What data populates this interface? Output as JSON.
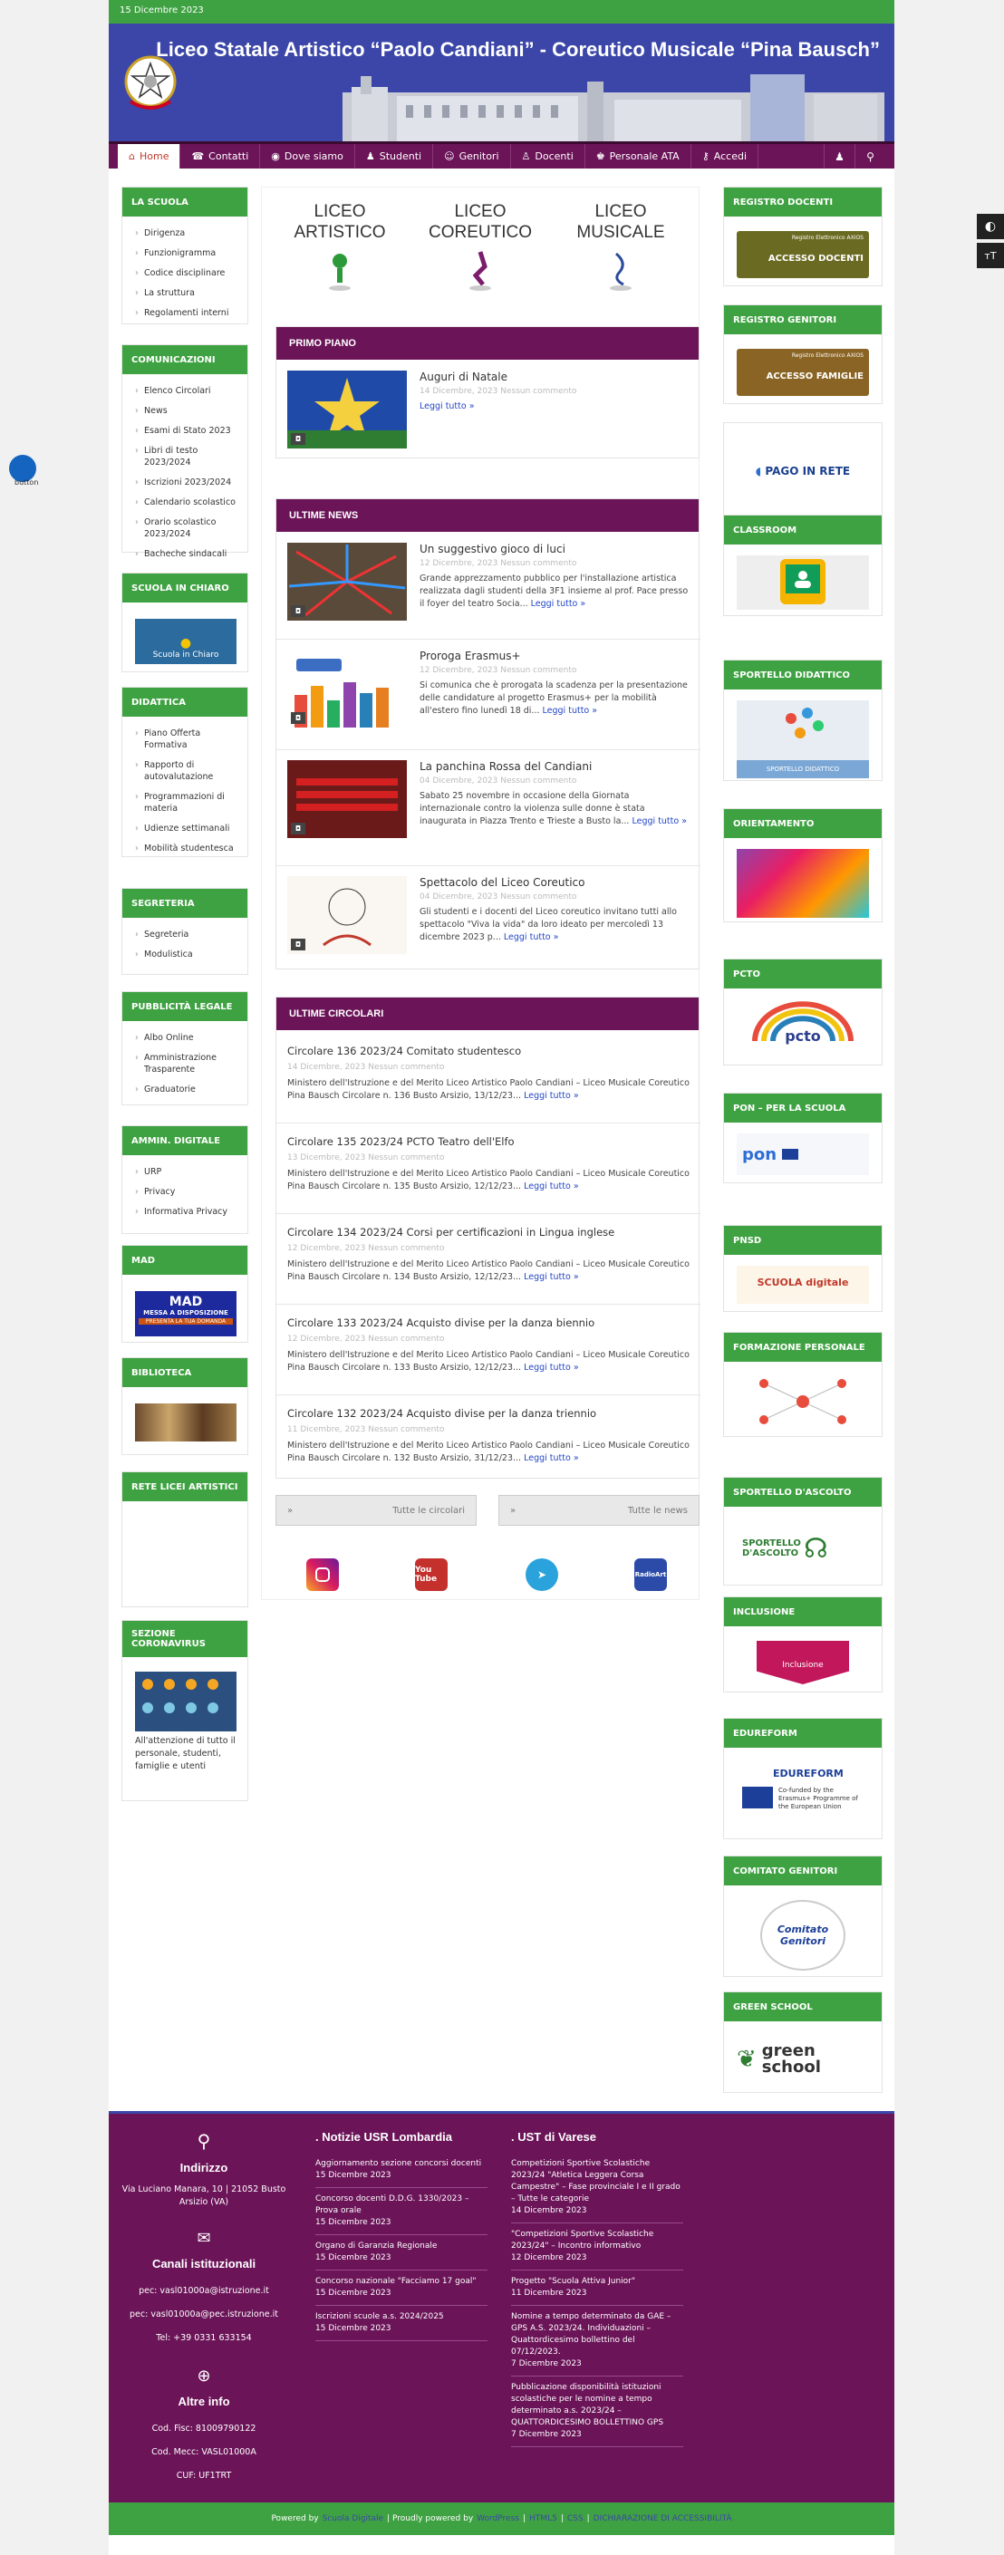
{
  "topbar": {
    "date": "15 Dicembre 2023"
  },
  "header": {
    "title": "Liceo Statale Artistico “Paolo Candiani” - Coreutico Musicale “Pina Bausch”"
  },
  "nav": {
    "items": [
      {
        "label": "Home",
        "icon": "home-icon",
        "active": true
      },
      {
        "label": "Contatti",
        "icon": "phone-icon"
      },
      {
        "label": "Dove siamo",
        "icon": "globe-icon"
      },
      {
        "label": "Studenti",
        "icon": "student-icon"
      },
      {
        "label": "Genitori",
        "icon": "parents-icon"
      },
      {
        "label": "Docenti",
        "icon": "teacher-icon"
      },
      {
        "label": "Personale ATA",
        "icon": "staff-icon"
      },
      {
        "label": "Accedi",
        "icon": "key-icon"
      }
    ]
  },
  "left": {
    "scuola": {
      "title": "LA SCUOLA",
      "items": [
        "Dirigenza",
        "Funzionigramma",
        "Codice disciplinare",
        "La struttura",
        "Regolamenti interni"
      ]
    },
    "comunicazioni": {
      "title": "COMUNICAZIONI",
      "items": [
        "Elenco Circolari",
        "News",
        "Esami di Stato 2023",
        "Libri di testo 2023/2024",
        "Iscrizioni 2023/2024",
        "Calendario scolastico",
        "Orario scolastico 2023/2024",
        "Bacheche sindacali"
      ]
    },
    "chiaro": {
      "title": "SCUOLA IN CHIARO",
      "img": "Scuola in Chiaro"
    },
    "didattica": {
      "title": "DIDATTICA",
      "items": [
        "Piano Offerta Formativa",
        "Rapporto di autovalutazione",
        "Programmazioni di materia",
        "Udienze settimanali",
        "Mobilità studentesca"
      ]
    },
    "segreteria": {
      "title": "SEGRETERIA",
      "items": [
        "Segreteria",
        "Modulistica"
      ]
    },
    "pubblicita": {
      "title": "PUBBLICITÀ LEGALE",
      "items": [
        "Albo Online",
        "Amministrazione Trasparente",
        "Graduatorie"
      ]
    },
    "digitale": {
      "title": "AMMIN. DIGITALE",
      "items": [
        "URP",
        "Privacy",
        "Informativa Privacy"
      ]
    },
    "mad": {
      "title": "MAD",
      "img1": "MAD",
      "img2": "MESSA A DISPOSIZIONE",
      "img3": "PRESENTA LA TUA DOMANDA"
    },
    "biblioteca": {
      "title": "BIBLIOTECA"
    },
    "rete": {
      "title": "RETE LICEI ARTISTICI"
    },
    "corona": {
      "title": "SEZIONE CORONAVIRUS",
      "text": "All'attenzione di tutto il personale, studenti, famiglie e utenti"
    }
  },
  "triad": [
    "LICEO ARTISTICO",
    "LICEO COREUTICO",
    "LICEO MUSICALE"
  ],
  "primo": {
    "title": "PRIMO PIANO",
    "news": {
      "title": "Auguri di Natale",
      "meta": "14 Dicembre, 2023   Nessun commento",
      "more": "Leggi tutto »"
    }
  },
  "ultime": {
    "title": "ULTIME NEWS",
    "news": [
      {
        "title": "Un suggestivo gioco di luci",
        "meta": "12 Dicembre, 2023   Nessun commento",
        "excerpt": "Grande apprezzamento pubblico per l'installazione artistica realizzata dagli studenti della 3F1 insieme al prof. Pace presso il foyer del teatro Socia...",
        "more": "Leggi tutto »"
      },
      {
        "title": "Proroga Erasmus+",
        "meta": "12 Dicembre, 2023   Nessun commento",
        "excerpt": "Si comunica che è prorogata la scadenza per la presentazione delle candidature al progetto Erasmus+ per la mobilità all'estero fino lunedì 18 di...",
        "more": "Leggi tutto »"
      },
      {
        "title": "La panchina Rossa del Candiani",
        "meta": "04 Dicembre, 2023   Nessun commento",
        "excerpt": "Sabato 25 novembre in occasione della Giornata internazionale contro la violenza sulle donne è stata inaugurata in Piazza Trento e Trieste a Busto la...",
        "more": "Leggi tutto »"
      },
      {
        "title": "Spettacolo del Liceo Coreutico",
        "meta": "04 Dicembre, 2023   Nessun commento",
        "excerpt": "Gli studenti e i docenti del Liceo coreutico invitano tutti allo spettacolo \"Viva la vida\" da loro ideato per mercoledì 13 dicembre 2023 p...",
        "more": "Leggi tutto »"
      }
    ]
  },
  "circolari": {
    "title": "ULTIME CIRCOLARI",
    "items": [
      {
        "title": "Circolare 136 2023/24 Comitato studentesco",
        "meta": "14 Dicembre, 2023   Nessun commento",
        "excerpt": "Ministero dell'Istruzione e del Merito Liceo Artistico Paolo Candiani – Liceo Musicale Coreutico Pina Bausch Circolare n. 136 Busto Arsizio, 13/12/23...",
        "more": "Leggi tutto »"
      },
      {
        "title": "Circolare 135 2023/24 PCTO Teatro dell'Elfo",
        "meta": "13 Dicembre, 2023   Nessun commento",
        "excerpt": "Ministero dell'Istruzione e del Merito Liceo Artistico Paolo Candiani – Liceo Musicale Coreutico Pina Bausch Circolare n. 135 Busto Arsizio, 12/12/23...",
        "more": "Leggi tutto »"
      },
      {
        "title": "Circolare 134 2023/24 Corsi per certificazioni in Lingua inglese",
        "meta": "12 Dicembre, 2023   Nessun commento",
        "excerpt": "Ministero dell'Istruzione e del Merito Liceo Artistico Paolo Candiani – Liceo Musicale Coreutico Pina Bausch Circolare n. 134 Busto Arsizio, 12/12/23...",
        "more": "Leggi tutto »"
      },
      {
        "title": "Circolare 133 2023/24 Acquisto divise per la danza biennio",
        "meta": "12 Dicembre, 2023   Nessun commento",
        "excerpt": "Ministero dell'Istruzione e del Merito Liceo Artistico Paolo Candiani – Liceo Musicale Coreutico Pina Bausch Circolare n. 133 Busto Arsizio, 12/12/23...",
        "more": "Leggi tutto »"
      },
      {
        "title": "Circolare 132 2023/24 Acquisto divise per la danza triennio",
        "meta": "11 Dicembre, 2023   Nessun commento",
        "excerpt": "Ministero dell'Istruzione e del Merito Liceo Artistico Paolo Candiani – Liceo Musicale Coreutico Pina Bausch Circolare n. 132 Busto Arsizio, 31/12/23...",
        "more": "Leggi tutto »"
      }
    ]
  },
  "buttons": {
    "circolari": "Tutte le circolari",
    "news": "Tutte le news"
  },
  "social": [
    "Instagram",
    "You Tube",
    "Telegram",
    "RadioArt"
  ],
  "right": [
    {
      "title": "REGISTRO DOCENTI",
      "img": "ACCESSO DOCENTI",
      "sub": "Registro Elettronico AXIOS"
    },
    {
      "title": "REGISTRO GENITORI",
      "img": "ACCESSO FAMIGLIE",
      "sub": "Registro Elettronico AXIOS"
    },
    {
      "title": "",
      "img": "PAGO IN RETE"
    },
    {
      "title": "CLASSROOM"
    },
    {
      "title": "SPORTELLO DIDATTICO",
      "img": "SPORTELLO DIDATTICO"
    },
    {
      "title": "ORIENTAMENTO"
    },
    {
      "title": "PCTO",
      "img": "pcto"
    },
    {
      "title": "PON – PER LA SCUOLA",
      "img": "pon"
    },
    {
      "title": "PNSD",
      "img": "SCUOLA digitale"
    },
    {
      "title": "FORMAZIONE PERSONALE"
    },
    {
      "title": "SPORTELLO D'ASCOLTO",
      "img": "SPORTELLO D'ASCOLTO"
    },
    {
      "title": "INCLUSIONE",
      "img": "Inclusione"
    },
    {
      "title": "EDUREFORM",
      "img": "EDUREFORM",
      "sub": "Co-funded by the Erasmus+ Programme of the European Union"
    },
    {
      "title": "COMITATO GENITORI",
      "img": "Comitato Genitori"
    },
    {
      "title": "GREEN SCHOOL",
      "img": "green school"
    }
  ],
  "footer": {
    "indirizzo": {
      "title": "Indirizzo",
      "text": "Via Luciano Manara, 10 | 21052 Busto Arsizio (VA)"
    },
    "canali": {
      "title": "Canali istituzionali",
      "pec": "pec: vasl01000a@istruzione.it",
      "pec2": "pec: vasl01000a@pec.istruzione.it",
      "tel": "Tel: +39 0331 633154"
    },
    "altre": {
      "title": "Altre info",
      "cf": "Cod. Fisc: 81009790122",
      "mecc": "Cod. Mecc: VASL01000A",
      "cuf": "CUF: UF1TRT"
    },
    "usr": {
      "title": "Notizie USR Lombardia",
      "items": [
        {
          "t": "Aggiornamento sezione concorsi docenti",
          "d": "15 Dicembre 2023"
        },
        {
          "t": "Concorso docenti D.D.G. 1330/2023 – Prova orale",
          "d": "15 Dicembre 2023"
        },
        {
          "t": "Organo di Garanzia Regionale",
          "d": "15 Dicembre 2023"
        },
        {
          "t": "Concorso nazionale \"Facciamo 17 goal\"",
          "d": "15 Dicembre 2023"
        },
        {
          "t": "Iscrizioni scuole a.s. 2024/2025",
          "d": "15 Dicembre 2023"
        }
      ]
    },
    "ust": {
      "title": "UST di Varese",
      "items": [
        {
          "t": "Competizioni Sportive Scolastiche 2023/24 \"Atletica Leggera Corsa Campestre\" – Fase provinciale I e II grado – Tutte le categorie",
          "d": "14 Dicembre 2023"
        },
        {
          "t": "\"Competizioni Sportive Scolastiche 2023/24\" – Incontro informativo",
          "d": "12 Dicembre 2023"
        },
        {
          "t": "Progetto \"Scuola Attiva Junior\"",
          "d": "11 Dicembre 2023"
        },
        {
          "t": "Nomine a tempo determinato da GAE – GPS A.S. 2023/24. Individuazioni – Quattordicesimo bollettino del 07/12/2023.",
          "d": "7 Dicembre 2023"
        },
        {
          "t": "Pubblicazione disponibilità istituzioni scolastiche per le nomine a tempo determinato a.s. 2023/24 – QUATTORDICESIMO BOLLETTINO GPS",
          "d": "7 Dicembre 2023"
        }
      ]
    }
  },
  "subfooter": {
    "powered": "Powered by",
    "scuola": "Scuola Digitale",
    "proudly": "| Proudly powered by",
    "wp": "WordPress",
    "sep": "|",
    "html5": "HTML5",
    "css": "CSS",
    "dich": "DICHIARAZIONE DI ACCESSIBILITÀ"
  },
  "widget": {
    "label": "button"
  },
  "colors": {
    "green": "#3fa242",
    "purple": "#6b1458",
    "blue": "#3b46a8"
  }
}
